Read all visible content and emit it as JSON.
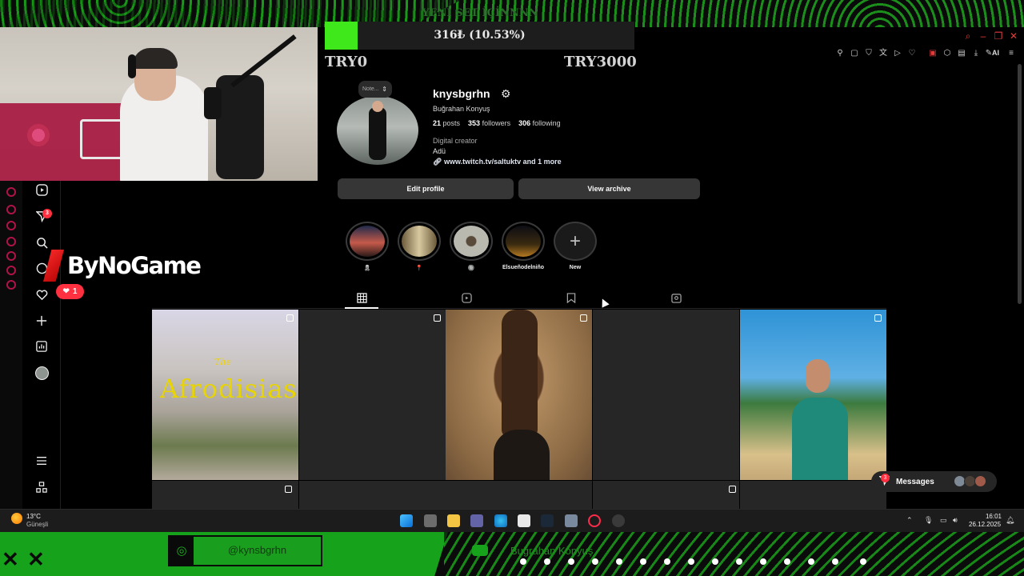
{
  "overlay": {
    "set_title": "YENİ SET İÇİNNNN",
    "donation_text": "316₺ (10.53%)",
    "donation_progress": 0.1053,
    "try_min": "TRY0",
    "try_max": "TRY3000",
    "brand": "ByNoGame",
    "instagram_handle": "@kynsbgrhn",
    "youtube_name": "Buğrahan Konyuş",
    "accent_green": "#3ee81a"
  },
  "sidebar": {
    "notifications_badge": "3",
    "likes_badge": "1"
  },
  "profile": {
    "note_placeholder": "Note...",
    "username": "knysbgrhn",
    "full_name": "Buğrahan Konyuş",
    "posts_count": "21",
    "posts_label": "posts",
    "followers_count": "353",
    "followers_label": "followers",
    "following_count": "306",
    "following_label": "following",
    "category": "Digital creator",
    "bio": "Adü",
    "link": "www.twitch.tv/saltuktv and 1 more",
    "edit_profile": "Edit profile",
    "view_archive": "View archive"
  },
  "highlights": [
    {
      "label": "🎗"
    },
    {
      "label": "📍"
    },
    {
      "label": "🔘"
    },
    {
      "label": "Elsueñodelniño"
    },
    {
      "label": "New"
    }
  ],
  "posts": [
    {
      "title_small": "The",
      "title_big": "Afrodisias"
    }
  ],
  "messages": {
    "label": "Messages",
    "badge": "3"
  },
  "taskbar": {
    "temperature": "13°C",
    "weather": "Güneşli",
    "time": "16:01",
    "date": "26.12.2025"
  }
}
